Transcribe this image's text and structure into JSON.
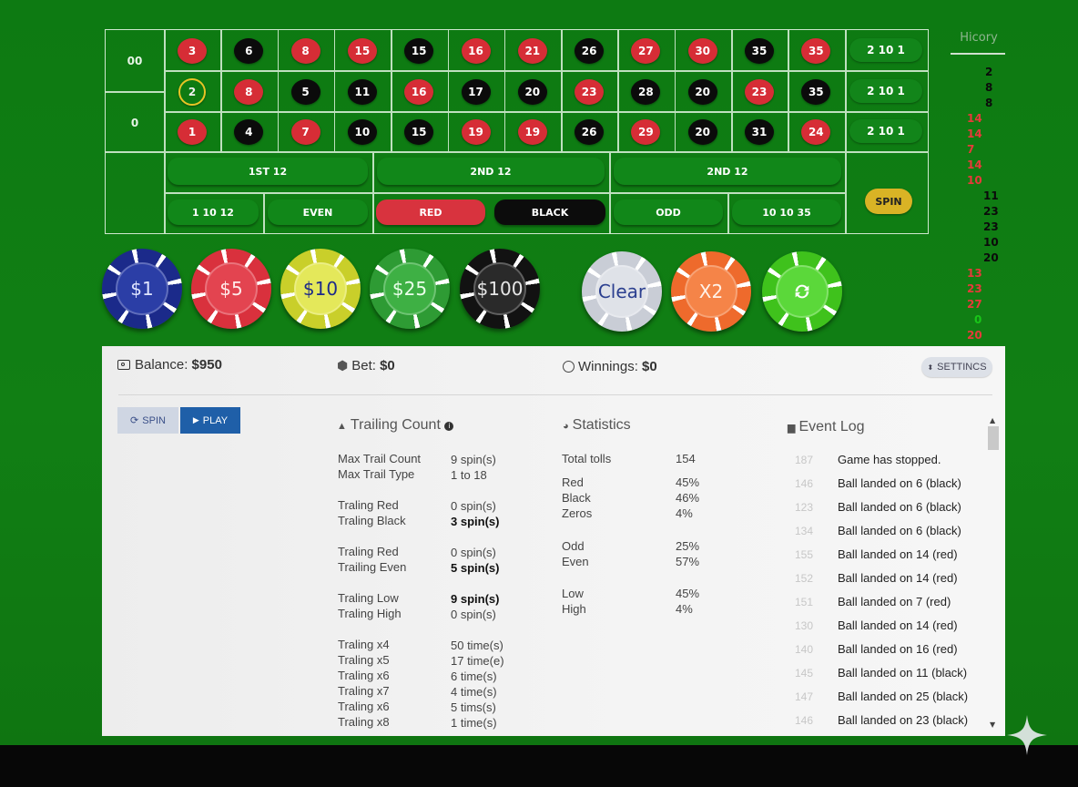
{
  "table": {
    "zeros": [
      "00",
      "0"
    ],
    "rows": [
      [
        {
          "n": "3",
          "c": "red"
        },
        {
          "n": "6",
          "c": "black"
        },
        {
          "n": "8",
          "c": "red"
        },
        {
          "n": "15",
          "c": "red"
        },
        {
          "n": "15",
          "c": "black"
        },
        {
          "n": "16",
          "c": "red"
        },
        {
          "n": "21",
          "c": "red"
        },
        {
          "n": "26",
          "c": "black"
        },
        {
          "n": "27",
          "c": "red"
        },
        {
          "n": "30",
          "c": "red"
        },
        {
          "n": "35",
          "c": "black"
        },
        {
          "n": "35",
          "c": "red"
        }
      ],
      [
        {
          "n": "2",
          "c": "selected"
        },
        {
          "n": "8",
          "c": "red"
        },
        {
          "n": "5",
          "c": "black"
        },
        {
          "n": "11",
          "c": "black"
        },
        {
          "n": "16",
          "c": "red"
        },
        {
          "n": "17",
          "c": "black"
        },
        {
          "n": "20",
          "c": "black"
        },
        {
          "n": "23",
          "c": "red"
        },
        {
          "n": "28",
          "c": "black"
        },
        {
          "n": "20",
          "c": "black"
        },
        {
          "n": "23",
          "c": "red"
        },
        {
          "n": "35",
          "c": "black"
        }
      ],
      [
        {
          "n": "1",
          "c": "red"
        },
        {
          "n": "4",
          "c": "black"
        },
        {
          "n": "7",
          "c": "red"
        },
        {
          "n": "10",
          "c": "black"
        },
        {
          "n": "15",
          "c": "black"
        },
        {
          "n": "19",
          "c": "red"
        },
        {
          "n": "19",
          "c": "red"
        },
        {
          "n": "26",
          "c": "black"
        },
        {
          "n": "29",
          "c": "red"
        },
        {
          "n": "20",
          "c": "black"
        },
        {
          "n": "31",
          "c": "black"
        },
        {
          "n": "24",
          "c": "red"
        }
      ]
    ],
    "columns": [
      "2 10 1",
      "2 10 1",
      "2 10 1"
    ],
    "dozens": [
      "1ST 12",
      "2ND 12",
      "2ND 12"
    ],
    "outside": [
      {
        "label": "1 10 12",
        "style": "green"
      },
      {
        "label": "EVEN",
        "style": "green"
      },
      {
        "label": "RED",
        "style": "red"
      },
      {
        "label": "BLACK",
        "style": "black"
      },
      {
        "label": "ODD",
        "style": "green"
      },
      {
        "label": "10 10 35",
        "style": "green"
      }
    ],
    "spin_label": "SPIN"
  },
  "history": {
    "title": "Hicory",
    "items": [
      {
        "n": "2",
        "c": "black"
      },
      {
        "n": "8",
        "c": "black"
      },
      {
        "n": "8",
        "c": "black"
      },
      {
        "n": "14",
        "c": "red"
      },
      {
        "n": "14",
        "c": "red"
      },
      {
        "n": "7",
        "c": "red"
      },
      {
        "n": "14",
        "c": "red"
      },
      {
        "n": "10",
        "c": "red"
      },
      {
        "n": "11",
        "c": "black"
      },
      {
        "n": "23",
        "c": "black"
      },
      {
        "n": "23",
        "c": "black"
      },
      {
        "n": "10",
        "c": "black"
      },
      {
        "n": "20",
        "c": "black"
      },
      {
        "n": "13",
        "c": "red"
      },
      {
        "n": "23",
        "c": "red"
      },
      {
        "n": "27",
        "c": "red"
      },
      {
        "n": "0",
        "c": "green"
      },
      {
        "n": "20",
        "c": "red"
      }
    ]
  },
  "chips": [
    {
      "label": "$1",
      "base": "#1b2a8a",
      "inner": "#2b3ea6",
      "text": "#dfe4ff"
    },
    {
      "label": "$5",
      "base": "#d9313d",
      "inner": "#e34450",
      "text": "#ffeaea"
    },
    {
      "label": "$10",
      "base": "#c9cf2a",
      "inner": "#e4e85a",
      "text": "#1d2a8a"
    },
    {
      "label": "$25",
      "base": "#2e9b34",
      "inner": "#3eb044",
      "text": "#eaffea"
    },
    {
      "label": "$100",
      "base": "#121212",
      "inner": "#2a2a2a",
      "text": "#e6e6e6"
    },
    {
      "label": "Clear",
      "base": "#c9cdd6",
      "inner": "#dfe2e8",
      "text": "#2b3f8f"
    },
    {
      "label": "X2",
      "base": "#ee6a2c",
      "inner": "#f58448",
      "text": "#fff2e8"
    },
    {
      "label": "refresh",
      "icon": "refresh-icon",
      "base": "#3fc21c",
      "inner": "#5bd83a",
      "text": "#ffffff"
    }
  ],
  "status": {
    "balance_label": "Balance:",
    "balance": "$950",
    "bet_label": "Bet:",
    "bet": "$0",
    "winnings_label": "Winnings:",
    "winnings": "$0",
    "settings": "SETTINCS"
  },
  "controls": {
    "spin": "SPIN",
    "play": "PLAY"
  },
  "trailing": {
    "title": "Trailing Count",
    "rows": [
      {
        "label": "Max Trail Count",
        "value": "9 spin(s)",
        "bold": false
      },
      {
        "label": "Max Trail Type",
        "value": "1 to 18",
        "bold": false
      },
      {
        "label": "Traling Red",
        "value": "0 spin(s)",
        "bold": false
      },
      {
        "label": "Traling Black",
        "value": "3 spin(s)",
        "bold": true
      },
      {
        "label": "Traling Red",
        "value": "0 spin(s)",
        "bold": false
      },
      {
        "label": "Trailing Even",
        "value": "5 spin(s)",
        "bold": true
      },
      {
        "label": "Traling Low",
        "value": "9 spin(s)",
        "bold": true
      },
      {
        "label": "Traling High",
        "value": "0 spin(s)",
        "bold": false
      },
      {
        "label": "Traling x4",
        "value": "50 time(s)",
        "bold": false
      },
      {
        "label": "Traling x5",
        "value": "17 time(e)",
        "bold": false
      },
      {
        "label": "Traling x6",
        "value": "6 time(s)",
        "bold": false
      },
      {
        "label": "Traling x7",
        "value": "4 time(s)",
        "bold": false
      },
      {
        "label": "Traling x6",
        "value": "5 tims(s)",
        "bold": false
      },
      {
        "label": "Traling x8",
        "value": "1 time(s)",
        "bold": false
      }
    ]
  },
  "statistics": {
    "title": "Statistics",
    "rows": [
      {
        "label": "Total tolls",
        "value": "154"
      },
      {
        "label": "Red",
        "value": "45%"
      },
      {
        "label": "Black",
        "value": "46%"
      },
      {
        "label": "Zeros",
        "value": "4%"
      },
      {
        "label": "Odd",
        "value": "25%"
      },
      {
        "label": "Even",
        "value": "57%"
      },
      {
        "label": "Low",
        "value": "45%"
      },
      {
        "label": "High",
        "value": "4%"
      }
    ]
  },
  "eventlog": {
    "title": "Event Log",
    "items": [
      {
        "seq": "187",
        "text": "Game has stopped."
      },
      {
        "seq": "146",
        "text": "Ball landed on 6 (black)"
      },
      {
        "seq": "123",
        "text": "Ball landed on 6 (black)"
      },
      {
        "seq": "134",
        "text": "Ball landed on 6 (black)"
      },
      {
        "seq": "155",
        "text": "Ball landed on 14 (red)"
      },
      {
        "seq": "152",
        "text": "Ball landed on 14 (red)"
      },
      {
        "seq": "151",
        "text": "Ball landed on 7 (red)"
      },
      {
        "seq": "130",
        "text": "Ball landed on 14 (red)"
      },
      {
        "seq": "140",
        "text": "Ball landed on 16 (red)"
      },
      {
        "seq": "145",
        "text": "Ball landed on 11 (black)"
      },
      {
        "seq": "147",
        "text": "Ball landed on 25 (black)"
      },
      {
        "seq": "146",
        "text": "Ball landed on 23 (black)"
      }
    ]
  }
}
